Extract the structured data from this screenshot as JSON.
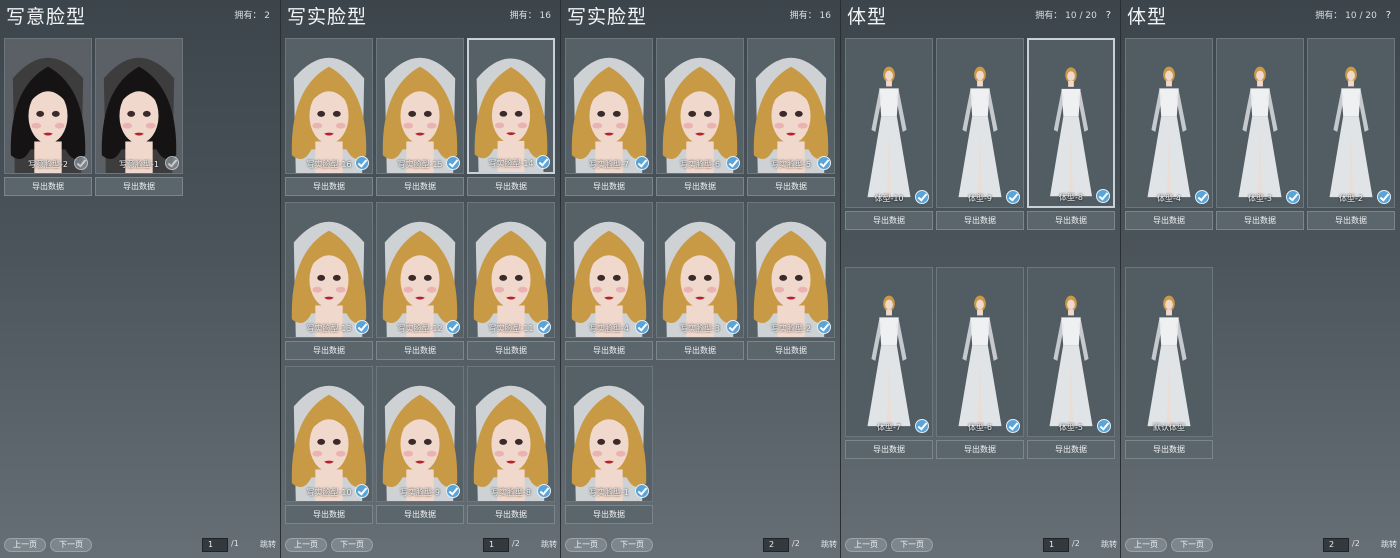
{
  "panels": [
    {
      "title": "写意脸型",
      "owned_label": "拥有：",
      "owned_value": "2",
      "cards": [
        {
          "label": "写意脸型-2",
          "button": "导出数据",
          "check": "dim"
        },
        {
          "label": "写意脸型-1",
          "button": "导出数据",
          "check": "dim"
        }
      ],
      "pager": {
        "prev": "上一页",
        "next": "下一页",
        "page": "1",
        "total": "/1",
        "go": "跳转"
      }
    },
    {
      "title": "写实脸型",
      "owned_label": "拥有：",
      "owned_value": "16",
      "cards": [
        {
          "label": "写实脸型-16",
          "button": "导出数据",
          "check": "on"
        },
        {
          "label": "写实脸型-15",
          "button": "导出数据",
          "check": "on"
        },
        {
          "label": "写实脸型-14",
          "button": "导出数据",
          "check": "on"
        },
        {
          "label": "写实脸型-13",
          "button": "导出数据",
          "check": "on"
        },
        {
          "label": "写实脸型-12",
          "button": "导出数据",
          "check": "on"
        },
        {
          "label": "写实脸型-11",
          "button": "导出数据",
          "check": "on"
        },
        {
          "label": "写实脸型-10",
          "button": "导出数据",
          "check": "on"
        },
        {
          "label": "写实脸型-9",
          "button": "导出数据",
          "check": "on"
        },
        {
          "label": "写实脸型-8",
          "button": "导出数据",
          "check": "on"
        }
      ],
      "pager": {
        "prev": "上一页",
        "next": "下一页",
        "page": "1",
        "total": "/2",
        "go": "跳转"
      }
    },
    {
      "title": "写实脸型",
      "owned_label": "拥有：",
      "owned_value": "16",
      "cards": [
        {
          "label": "写实脸型-7",
          "button": "导出数据",
          "check": "on"
        },
        {
          "label": "写实脸型-6",
          "button": "导出数据",
          "check": "on"
        },
        {
          "label": "写实脸型-5",
          "button": "导出数据",
          "check": "on"
        },
        {
          "label": "写实脸型-4",
          "button": "导出数据",
          "check": "on"
        },
        {
          "label": "写实脸型-3",
          "button": "导出数据",
          "check": "on"
        },
        {
          "label": "写实脸型-2",
          "button": "导出数据",
          "check": "on"
        },
        {
          "label": "写实脸型-1",
          "button": "导出数据",
          "check": "on"
        }
      ],
      "pager": {
        "prev": "上一页",
        "next": "下一页",
        "page": "2",
        "total": "/2",
        "go": "跳转"
      }
    },
    {
      "title": "体型",
      "owned_label": "拥有：",
      "owned_value": "10 / 20",
      "help": "?",
      "cards": [
        {
          "label": "体型-10",
          "button": "导出数据",
          "check": "on"
        },
        {
          "label": "体型-9",
          "button": "导出数据",
          "check": "on"
        },
        {
          "label": "体型-8",
          "button": "导出数据",
          "check": "on"
        },
        {
          "label": "体型-7",
          "button": "导出数据",
          "check": "on"
        },
        {
          "label": "体型-6",
          "button": "导出数据",
          "check": "on"
        },
        {
          "label": "体型-5",
          "button": "导出数据",
          "check": "on"
        }
      ],
      "pager": {
        "prev": "上一页",
        "next": "下一页",
        "page": "1",
        "total": "/2",
        "go": "跳转"
      }
    },
    {
      "title": "体型",
      "owned_label": "拥有：",
      "owned_value": "10 / 20",
      "help": "?",
      "cards": [
        {
          "label": "体型-4",
          "button": "导出数据",
          "check": "on"
        },
        {
          "label": "体型-3",
          "button": "导出数据",
          "check": "on"
        },
        {
          "label": "体型-2",
          "button": "导出数据",
          "check": "on"
        },
        {
          "label": "默认体型",
          "button": "导出数据",
          "check": "none"
        }
      ],
      "pager": {
        "prev": "上一页",
        "next": "下一页",
        "page": "2",
        "total": "/2",
        "go": "跳转"
      }
    }
  ],
  "colors": {
    "hair_blonde": "#c99a45",
    "hair_black": "#151313",
    "skin": "#f0d8cc",
    "veil": "#e4e6e8",
    "gown": "#eef0f2",
    "check_accent": "#5aa4d8"
  }
}
